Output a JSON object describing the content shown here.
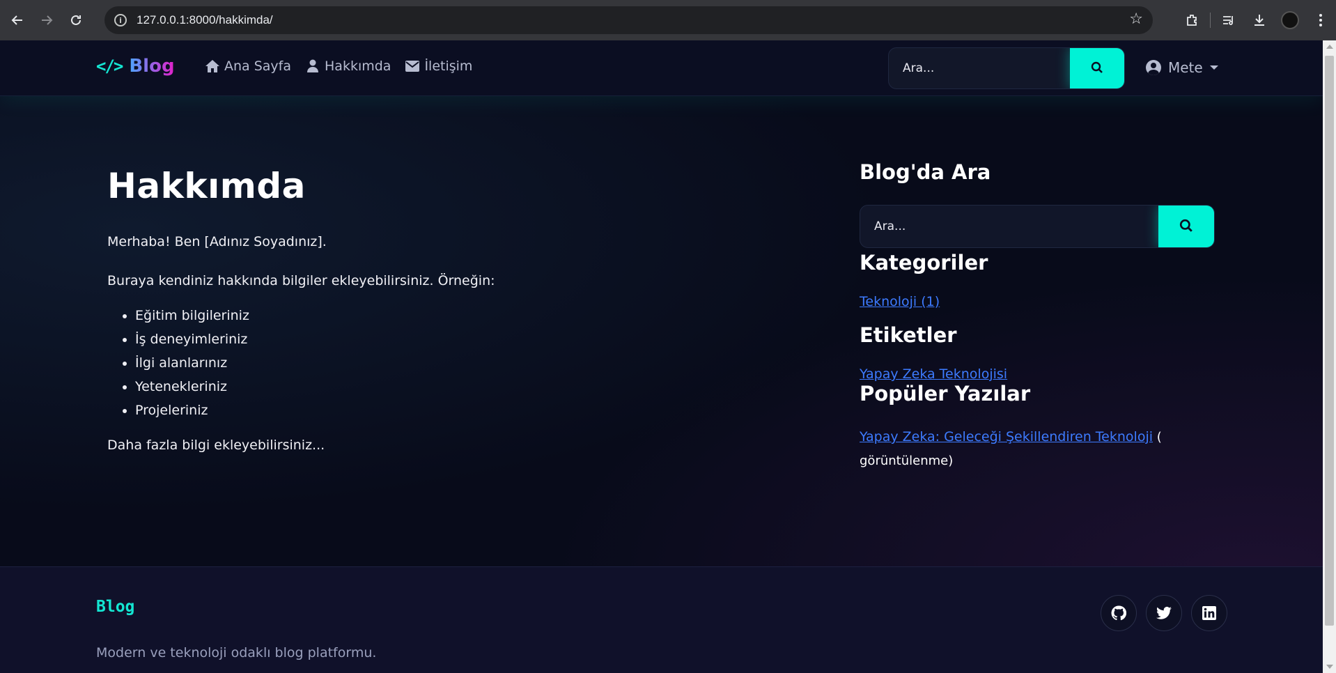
{
  "browser": {
    "url": "127.0.0.1:8000/hakkimda/"
  },
  "navbar": {
    "brand_code": "</>",
    "brand": "Blog",
    "links": [
      {
        "label": "Ana Sayfa",
        "icon": "home-icon"
      },
      {
        "label": "Hakkımda",
        "icon": "user-icon"
      },
      {
        "label": "İletişim",
        "icon": "envelope-icon"
      }
    ],
    "search_placeholder": "Ara...",
    "user": "Mete"
  },
  "main": {
    "title": "Hakkımda",
    "intro": "Merhaba! Ben [Adınız Soyadınız].",
    "lead": "Buraya kendiniz hakkında bilgiler ekleyebilirsiniz. Örneğin:",
    "items": [
      "Eğitim bilgileriniz",
      "İş deneyimleriniz",
      "İlgi alanlarınız",
      "Yetenekleriniz",
      "Projeleriniz"
    ],
    "outro": "Daha fazla bilgi ekleyebilirsiniz..."
  },
  "sidebar": {
    "search_heading": "Blog'da Ara",
    "search_placeholder": "Ara...",
    "categories_heading": "Kategoriler",
    "categories": [
      "Teknoloji (1)"
    ],
    "tags_heading": "Etiketler",
    "tags": [
      "Yapay Zeka Teknolojisi"
    ],
    "popular_heading": "Popüler Yazılar",
    "popular": [
      {
        "title": "Yapay Zeka: Geleceği Şekillendiren Teknoloji",
        "suffix_a": " (",
        "suffix_b": "görüntülenme)"
      }
    ]
  },
  "footer": {
    "brand": "Blog",
    "description": "Modern ve teknoloji odaklı blog platformu.",
    "social": [
      "github-icon",
      "twitter-icon",
      "linkedin-icon"
    ]
  },
  "colors": {
    "accent": "#00f2d6",
    "link": "#3d7bff",
    "background": "#080b1a"
  }
}
